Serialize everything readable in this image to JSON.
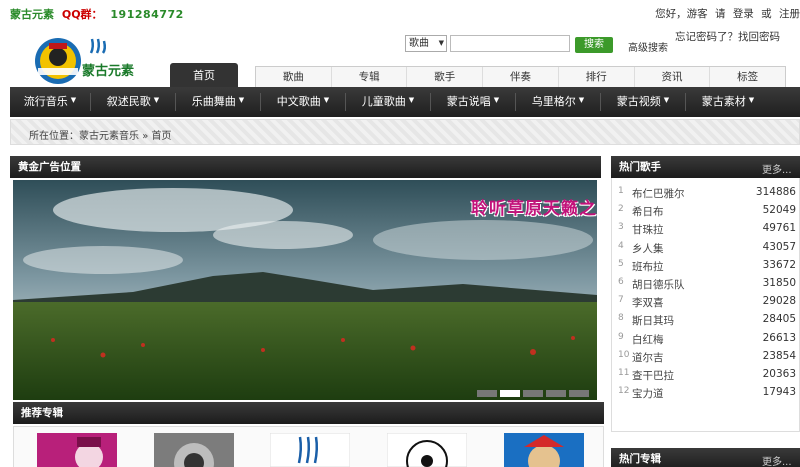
{
  "topbar": {
    "site_name": "蒙古元素",
    "qq_label": "QQ群：",
    "qq_number": "191284772",
    "greeting": "您好，游客",
    "please": "请",
    "login": "登录",
    "or": "或",
    "register": "注册",
    "forgot": "忘记密码了？找回密码"
  },
  "logo": {
    "text": "蒙古元素",
    "badge": "WWW.MGLYS.COM"
  },
  "search": {
    "select_value": "歌曲",
    "input_value": "",
    "button": "搜索",
    "advanced": "高级搜索"
  },
  "home_tab": "首页",
  "subtabs": [
    "歌曲",
    "专辑",
    "歌手",
    "伴奏",
    "排行",
    "资讯",
    "标签"
  ],
  "mainnav": [
    "流行音乐",
    "叙述民歌",
    "乐曲舞曲",
    "中文歌曲",
    "儿童歌曲",
    "蒙古说唱",
    "乌里格尔",
    "蒙古视频",
    "蒙古素材"
  ],
  "breadcrumb": {
    "prefix": "所在位置：",
    "site": "蒙古元素音乐",
    "sep": "»",
    "current": "首页"
  },
  "banner": {
    "header": "黄金广告位置",
    "caption": "聆听草原天籁之",
    "slides": 5,
    "active_slide": 2
  },
  "recommend": {
    "header": "推荐专辑"
  },
  "hot_singers": {
    "header": "热门歌手",
    "more": "更多...",
    "items": [
      {
        "name": "布仁巴雅尔",
        "count": "314886"
      },
      {
        "name": "希日布",
        "count": "52049"
      },
      {
        "name": "甘珠拉",
        "count": "49761"
      },
      {
        "name": "乡人集",
        "count": "43057"
      },
      {
        "name": "班布拉",
        "count": "33672"
      },
      {
        "name": "胡日德乐队",
        "count": "31850"
      },
      {
        "name": "李双喜",
        "count": "29028"
      },
      {
        "name": "斯日其玛",
        "count": "28405"
      },
      {
        "name": "白红梅",
        "count": "26613"
      },
      {
        "name": "道尔吉",
        "count": "23854"
      },
      {
        "name": "查干巴拉",
        "count": "20363"
      },
      {
        "name": "宝力道",
        "count": "17943"
      }
    ]
  },
  "hot_songs": {
    "header": "热门专辑",
    "more": "更多..."
  }
}
